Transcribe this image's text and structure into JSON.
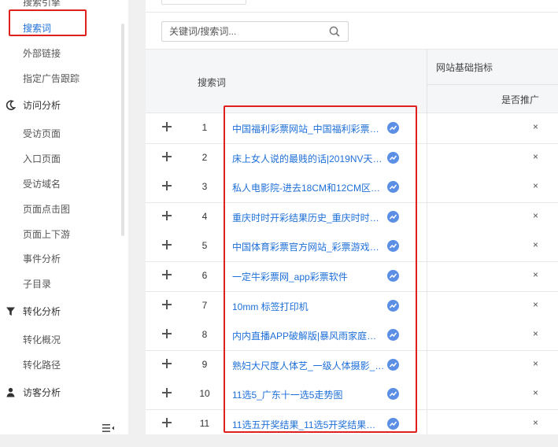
{
  "sidebar": {
    "top_cut": "搜索引擎",
    "search_words": "搜索词",
    "external_links": "外部链接",
    "ad_tracking": "指定广告跟踪",
    "visit_analysis": "访问分析",
    "visit_items": [
      "受访页面",
      "入口页面",
      "受访域名",
      "页面点击图",
      "页面上下游",
      "事件分析",
      "子目录"
    ],
    "conversion_analysis": "转化分析",
    "conversion_items": [
      "转化概况",
      "转化路径"
    ],
    "visitor_analysis": "访客分析"
  },
  "search": {
    "placeholder": "关键词/搜索词..."
  },
  "table": {
    "col_keyword": "搜索词",
    "col_group": "网站基础指标",
    "col_promo": "是否推广",
    "rows": [
      {
        "n": "1",
        "kw": "中国福利彩票网站_中国福利彩票新…",
        "promo": "×"
      },
      {
        "n": "2",
        "kw": "床上女人说的最贱的话|2019NV天…",
        "promo": "×"
      },
      {
        "n": "3",
        "kw": "私人电影院-进去18CM和12CM区…",
        "promo": "×"
      },
      {
        "n": "4",
        "kw": "重庆时时开彩结果历史_重庆时时开…",
        "promo": "×"
      },
      {
        "n": "5",
        "kw": "中国体育彩票官方网站_彩票游戏平台",
        "promo": "×"
      },
      {
        "n": "6",
        "kw": "一定牛彩票网_app彩票软件",
        "promo": "×"
      },
      {
        "n": "7",
        "kw": "10mm 标签打印机",
        "promo": "×"
      },
      {
        "n": "8",
        "kw": "内内直播APP破解版|暴风雨家庭教…",
        "promo": "×"
      },
      {
        "n": "9",
        "kw": "熟妇大尺度人体艺_一级人体摄影_…",
        "promo": "×"
      },
      {
        "n": "10",
        "kw": "11选5_广东十一选5走势图",
        "promo": "×"
      },
      {
        "n": "11",
        "kw": "11选五开奖结果_11选5开奖结果走…",
        "promo": "×"
      }
    ]
  },
  "colors": {
    "link": "#1e6fd9",
    "highlight": "#e0201c",
    "trend_icon": "#5b8fe6"
  }
}
